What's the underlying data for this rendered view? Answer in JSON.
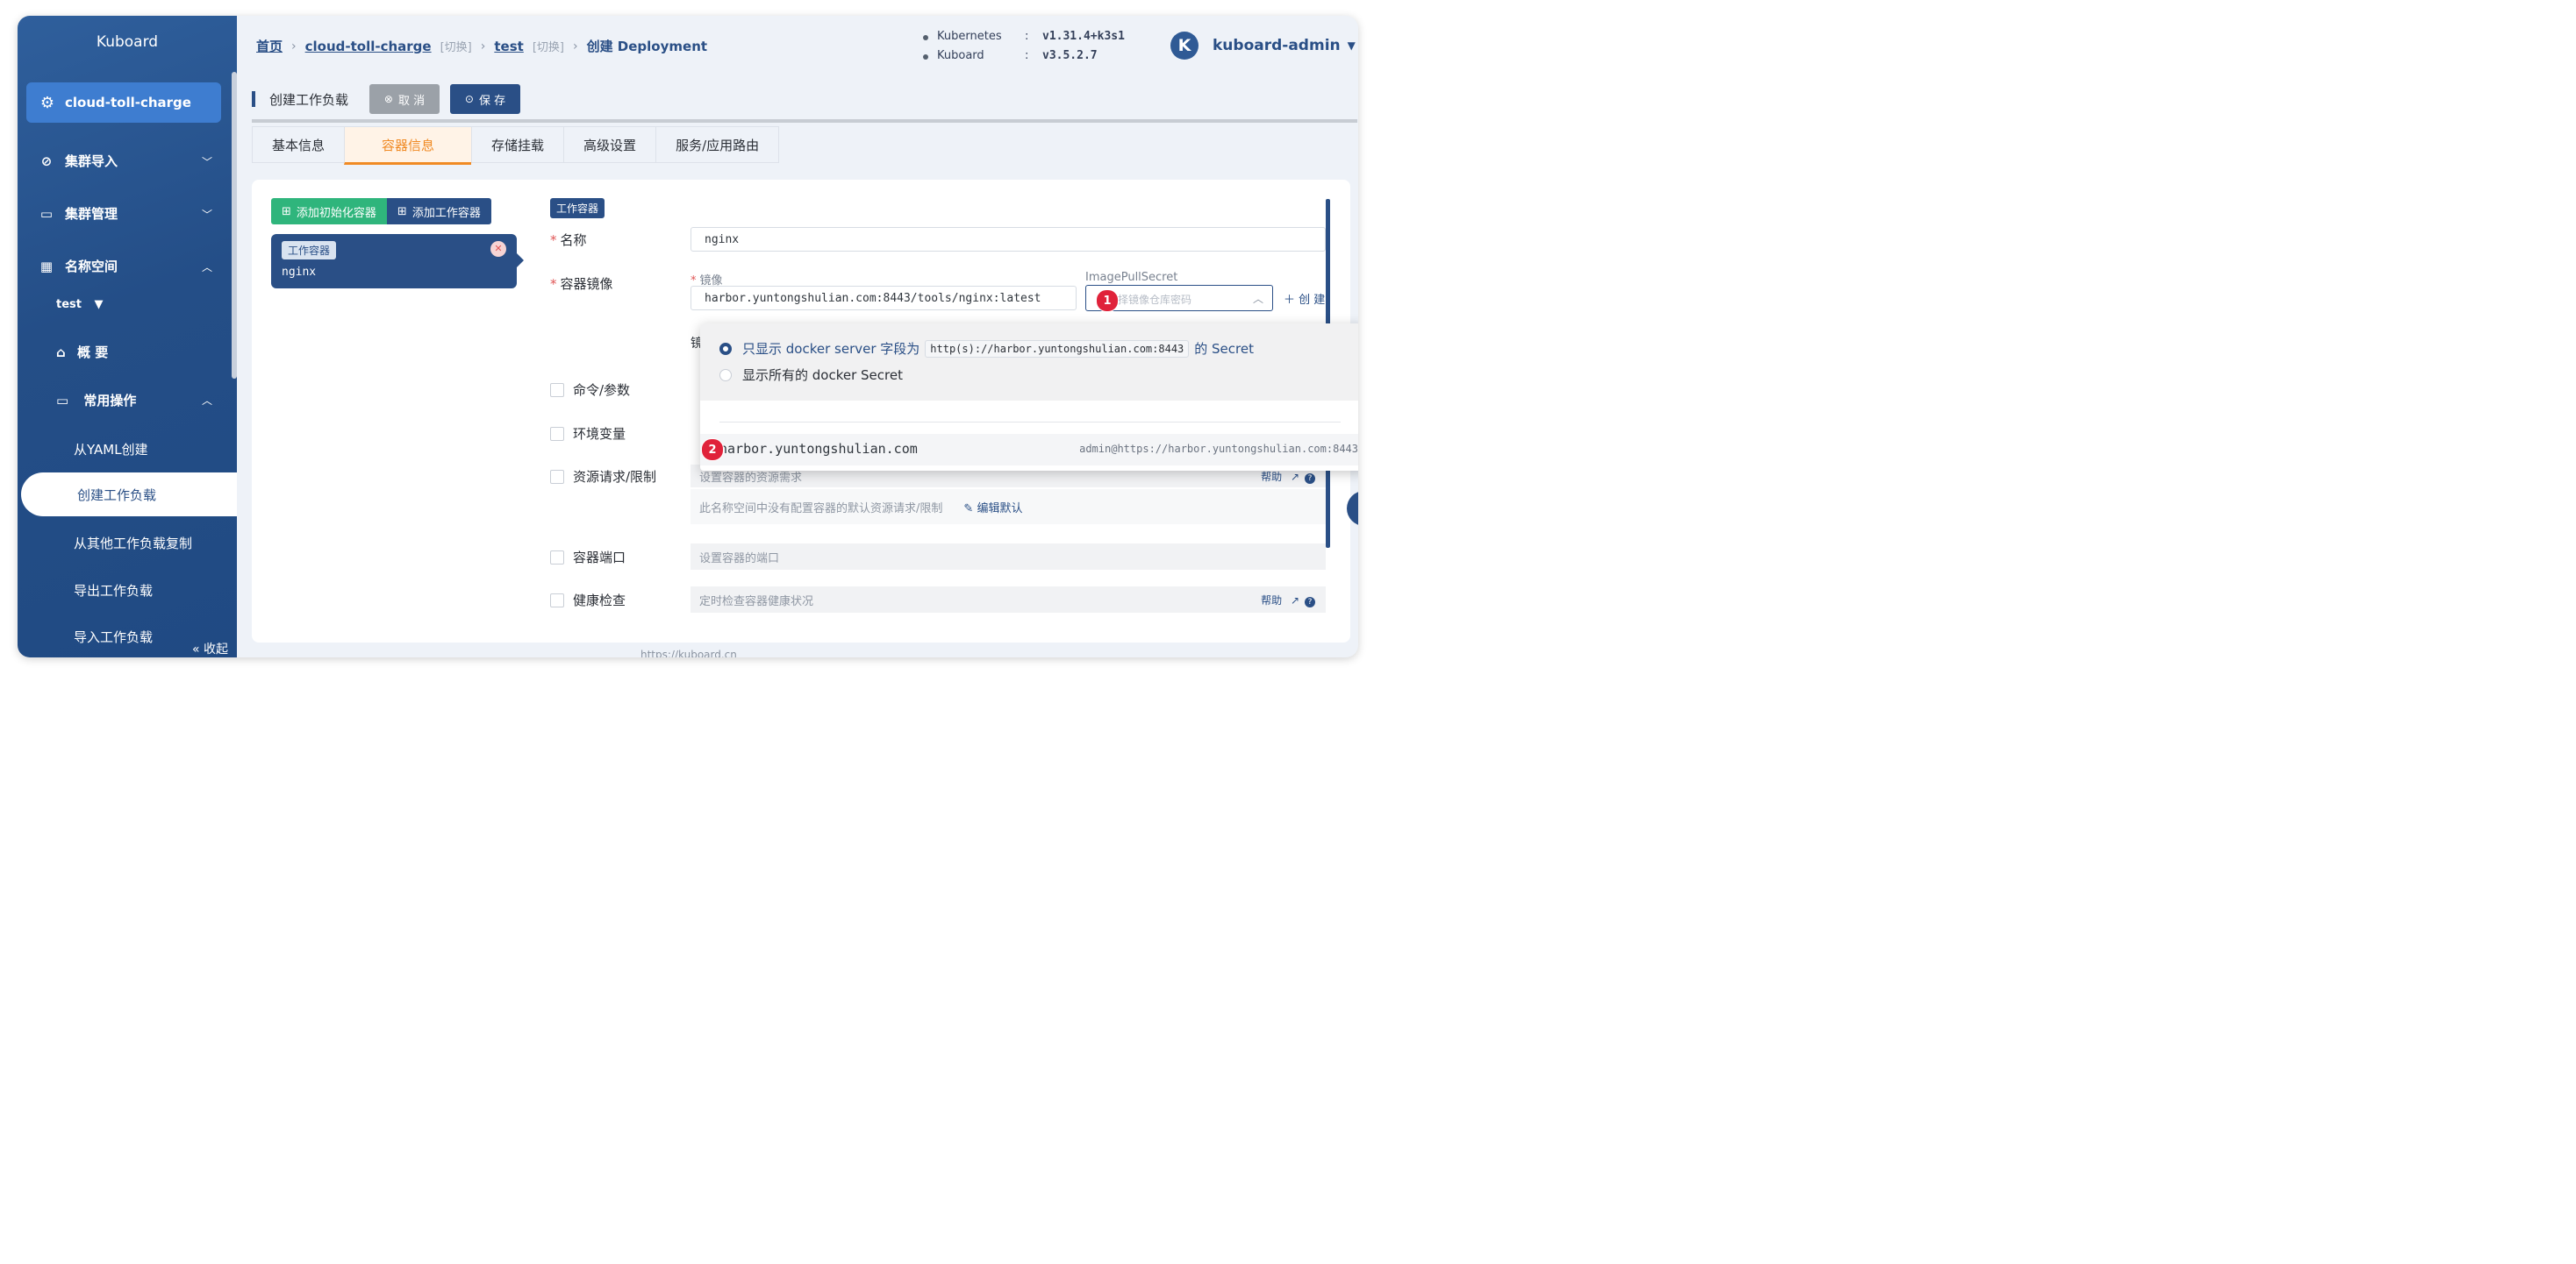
{
  "sidebar": {
    "logo": "Kuboard",
    "active_cluster": "cloud-toll-charge",
    "items": [
      {
        "label": "集群导入",
        "icon": "link-icon"
      },
      {
        "label": "集群管理",
        "icon": "folder-icon"
      },
      {
        "label": "名称空间",
        "icon": "grid-icon"
      }
    ],
    "namespace": "test",
    "sub_items": [
      {
        "label": "概 要"
      },
      {
        "label": "常用操作"
      },
      {
        "label": "从YAML创建"
      },
      {
        "label": "创建工作负载"
      },
      {
        "label": "从其他工作负载复制"
      },
      {
        "label": "导出工作负载"
      },
      {
        "label": "导入工作负载"
      }
    ],
    "collapse_label": "收起"
  },
  "header": {
    "breadcrumb": {
      "home": "首页",
      "cluster": "cloud-toll-charge",
      "switch": "[切换]",
      "namespace": "test",
      "current": "创建 Deployment"
    },
    "versions": [
      {
        "key": "Kubernetes",
        "value": "v1.31.4+k3s1"
      },
      {
        "key": "Kuboard",
        "value": "v3.5.2.7"
      }
    ],
    "user": {
      "initial": "K",
      "name": "kuboard-admin"
    }
  },
  "page": {
    "title": "创建工作负载",
    "cancel_label": "取 消",
    "save_label": "保 存"
  },
  "tabs": [
    {
      "label": "基本信息",
      "active": false
    },
    {
      "label": "容器信息",
      "active": true
    },
    {
      "label": "存储挂载",
      "active": false
    },
    {
      "label": "高级设置",
      "active": false
    },
    {
      "label": "服务/应用路由",
      "active": false
    }
  ],
  "containers": {
    "add_init_label": "添加初始化容器",
    "add_work_label": "添加工作容器",
    "card": {
      "tag": "工作容器",
      "name": "nginx"
    }
  },
  "form": {
    "section_tag": "工作容器",
    "name_label": "名称",
    "name_value": "nginx",
    "image_label": "容器镜像",
    "image_sublabel": "镜像",
    "image_value": "harbor.yuntongshulian.com:8443/tools/nginx:latest",
    "pull_secret_label": "ImagePullSecret",
    "pull_secret_placeholder": "择镜像仓库密码",
    "create_label": "创 建",
    "hidden_label_fragment": "镜",
    "command_label": "命令/参数",
    "env_label": "环境变量",
    "resource_label": "资源请求/限制",
    "resource_placeholder": "设置容器的资源需求",
    "resource_note": "此名称空间中没有配置容器的默认资源请求/限制",
    "edit_default_label": "编辑默认",
    "port_label": "容器端口",
    "port_placeholder": "设置容器的端口",
    "health_label": "健康检查",
    "health_placeholder": "定时检查容器健康状况",
    "help_label": "帮助"
  },
  "dropdown": {
    "option_filtered_prefix": "只显示 docker server 字段为",
    "option_filtered_code": "http(s)://harbor.yuntongshulian.com:8443",
    "option_filtered_suffix": "的 Secret",
    "option_all": "显示所有的 docker Secret",
    "secret_host": "harbor.yuntongshulian.com",
    "secret_account": "admin@https://harbor.yuntongshulian.com:8443"
  },
  "annotations": {
    "step1": "1",
    "step2": "2"
  },
  "footer_url": "https://kuboard.cn",
  "colors": {
    "brand": "#2a4f86",
    "active_tab": "#f08a24",
    "init_button": "#2fb57c",
    "badge": "#e0223a"
  }
}
